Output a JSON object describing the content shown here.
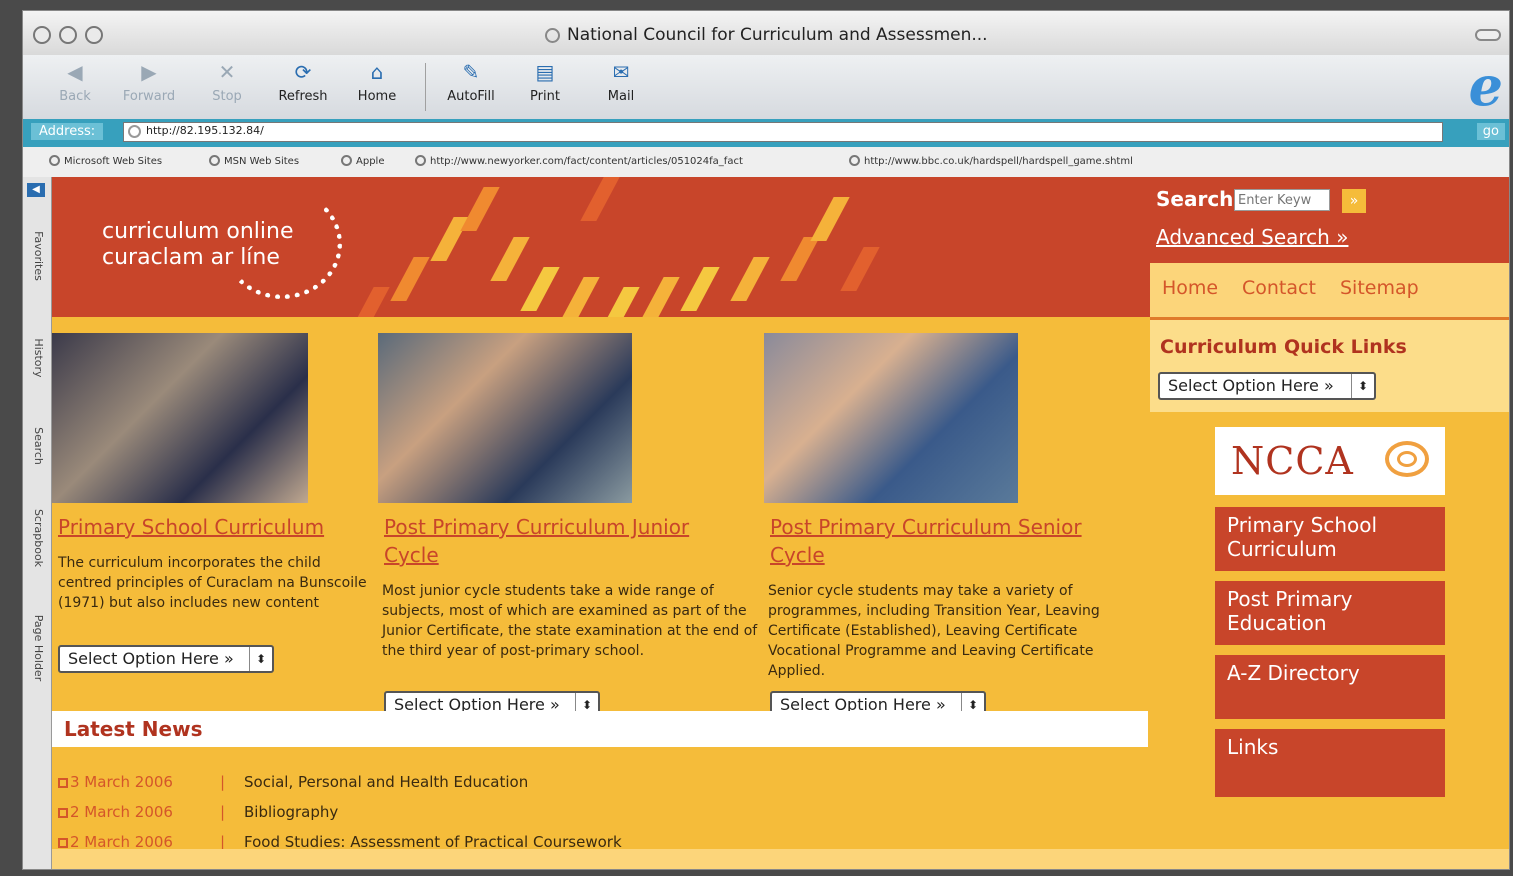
{
  "window": {
    "title": "National Council for Curriculum and Assessmen..."
  },
  "toolbar": {
    "buttons": [
      {
        "label": "Back",
        "icon": "back-arrow-icon"
      },
      {
        "label": "Forward",
        "icon": "forward-arrow-icon"
      },
      {
        "label": "Stop",
        "icon": "stop-x-icon"
      },
      {
        "label": "Refresh",
        "icon": "refresh-icon"
      },
      {
        "label": "Home",
        "icon": "home-icon"
      },
      {
        "label": "AutoFill",
        "icon": "autofill-icon"
      },
      {
        "label": "Print",
        "icon": "print-icon"
      },
      {
        "label": "Mail",
        "icon": "mail-icon"
      }
    ]
  },
  "address": {
    "label": "Address:",
    "url": "http://82.195.132.84/",
    "go_label": "go"
  },
  "favorites": [
    "Microsoft Web Sites",
    "MSN Web Sites",
    "Apple",
    "http://www.newyorker.com/fact/content/articles/051024fa_fact",
    "http://www.bbc.co.uk/hardspell/hardspell_game.shtml"
  ],
  "side_tabs": [
    "Favorites",
    "History",
    "Search",
    "Scrapbook",
    "Page Holder"
  ],
  "site": {
    "logo_line1": "curriculum online",
    "logo_line2": "curaclam ar líne",
    "search_label": "Search",
    "search_placeholder": "Enter Keyw",
    "search_go": "»",
    "advanced_search": "Advanced Search »",
    "nav": [
      "Home",
      "Contact",
      "Sitemap"
    ],
    "quick_links_title": "Curriculum Quick Links",
    "select_label": "Select Option Here »",
    "ncca": "NCCA",
    "side_buttons": [
      "Primary School Curriculum",
      "Post Primary Education",
      "A-Z Directory",
      "Links"
    ]
  },
  "columns": [
    {
      "title": "Primary School Curriculum",
      "text": "The curriculum incorporates the child centred principles of Curaclam na Bunscoile (1971) but also includes new content"
    },
    {
      "title": "Post Primary Curriculum Junior Cycle",
      "text": "Most junior cycle students take a wide range of subjects, most of which are examined as part of the Junior Certificate, the state examination at the end of the third year of post-primary school."
    },
    {
      "title": "Post Primary Curriculum Senior Cycle",
      "text": "Senior cycle students may take a variety of programmes, including Transition Year, Leaving Certificate (Established), Leaving Certificate Vocational Programme and Leaving Certificate Applied."
    }
  ],
  "news": {
    "title": "Latest News",
    "items": [
      {
        "date": "3 March 2006",
        "text": "Social, Personal and Health Education"
      },
      {
        "date": "2 March 2006",
        "text": "Bibliography"
      },
      {
        "date": "2 March 2006",
        "text": "Food Studies: Assessment of Practical Coursework"
      }
    ]
  },
  "colors": {
    "header_red": "#c8452a",
    "page_orange": "#f5bc3a",
    "link_orange": "#d4562a",
    "address_teal": "#37a0bd"
  }
}
